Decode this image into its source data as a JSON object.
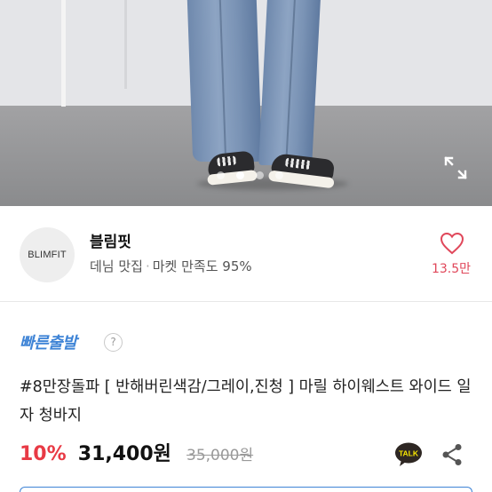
{
  "gallery": {
    "slide_count": 4,
    "active_slide": 1,
    "expand_icon": "expand-icon"
  },
  "shop": {
    "logo_text": "BLIMFIT",
    "name": "블림핏",
    "category": "데님 맛집",
    "separator": "·",
    "satisfaction": "마켓 만족도 95%",
    "like_count": "13.5만",
    "heart_color": "#e0475a"
  },
  "delivery": {
    "fast_label": "빠른출발",
    "help_label": "?"
  },
  "product": {
    "title": "#8만장돌파 [ 반해버린색감/그레이,진청 ] 마릴 하이웨스트 와이드 일자 청바지",
    "discount": "10%",
    "price": "31,400원",
    "original_price": "35,000원",
    "talk_label": "TALK"
  },
  "colors": {
    "accent_blue": "#3f84d6",
    "sale_red": "#e83a45"
  }
}
